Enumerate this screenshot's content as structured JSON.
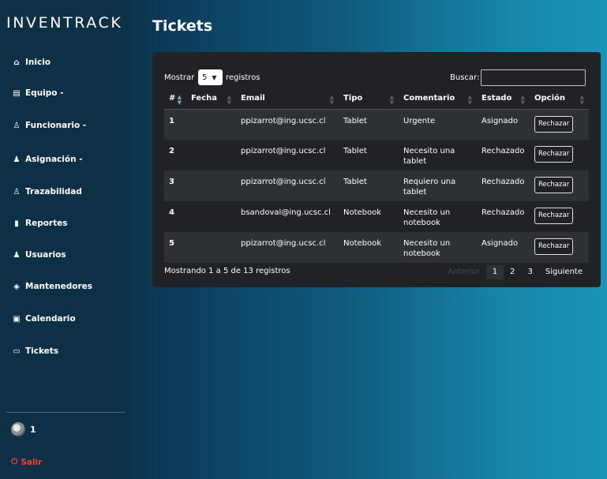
{
  "sidebar": {
    "brand": "INVENTRACK",
    "items": [
      {
        "label": "Inicio",
        "icon": "home-icon",
        "glyph": "⌂"
      },
      {
        "label": "Equipo -",
        "icon": "equipment-icon",
        "glyph": "▤"
      },
      {
        "label": "Funcionario -",
        "icon": "person-icon",
        "glyph": "♙"
      },
      {
        "label": "Asignación -",
        "icon": "users-icon",
        "glyph": "♟"
      },
      {
        "label": "Trazabilidad",
        "icon": "trace-icon",
        "glyph": "♙"
      },
      {
        "label": "Reportes",
        "icon": "report-icon",
        "glyph": "▮"
      },
      {
        "label": "Usuarios",
        "icon": "user-icon",
        "glyph": "♟"
      },
      {
        "label": "Mantenedores",
        "icon": "box-icon",
        "glyph": "◈"
      },
      {
        "label": "Calendario",
        "icon": "calendar-icon",
        "glyph": "▣"
      },
      {
        "label": "Tickets",
        "icon": "ticket-icon",
        "glyph": "▭"
      }
    ],
    "user_name": "1",
    "logout_label": "Salir",
    "logout_color": "#ff3b3b"
  },
  "main": {
    "title": "Tickets"
  },
  "table_controls": {
    "show_label": "Mostrar",
    "page_size": "5",
    "records_label": "registros",
    "search_label": "Buscar:",
    "search_value": ""
  },
  "table": {
    "columns": [
      "#",
      "Fecha",
      "Email",
      "Tipo",
      "Comentario",
      "Estado",
      "Opción"
    ],
    "rows": [
      {
        "num": "1",
        "fecha": "",
        "email": "ppizarrot@ing.ucsc.cl",
        "tipo": "Tablet",
        "comentario": "Urgente",
        "estado": "Asignado",
        "opcion": "Rechazar"
      },
      {
        "num": "2",
        "fecha": "",
        "email": "ppizarrot@ing.ucsc.cl",
        "tipo": "Tablet",
        "comentario": "Necesito una tablet",
        "estado": "Rechazado",
        "opcion": "Rechazar"
      },
      {
        "num": "3",
        "fecha": "",
        "email": "ppizarrot@ing.ucsc.cl",
        "tipo": "Tablet",
        "comentario": "Requiero una tablet",
        "estado": "Rechazado",
        "opcion": "Rechazar"
      },
      {
        "num": "4",
        "fecha": "",
        "email": "bsandoval@ing.ucsc.cl",
        "tipo": "Notebook",
        "comentario": "Necesito un notebook",
        "estado": "Rechazado",
        "opcion": "Rechazar"
      },
      {
        "num": "5",
        "fecha": "",
        "email": "ppizarrot@ing.ucsc.cl",
        "tipo": "Notebook",
        "comentario": "Necesito un notebook",
        "estado": "Asignado",
        "opcion": "Rechazar"
      }
    ]
  },
  "footer": {
    "info": "Mostrando 1 a 5 de 13 registros",
    "prev_label": "Anterior",
    "pages": [
      "1",
      "2",
      "3"
    ],
    "current_page": "1",
    "next_label": "Siguiente"
  }
}
